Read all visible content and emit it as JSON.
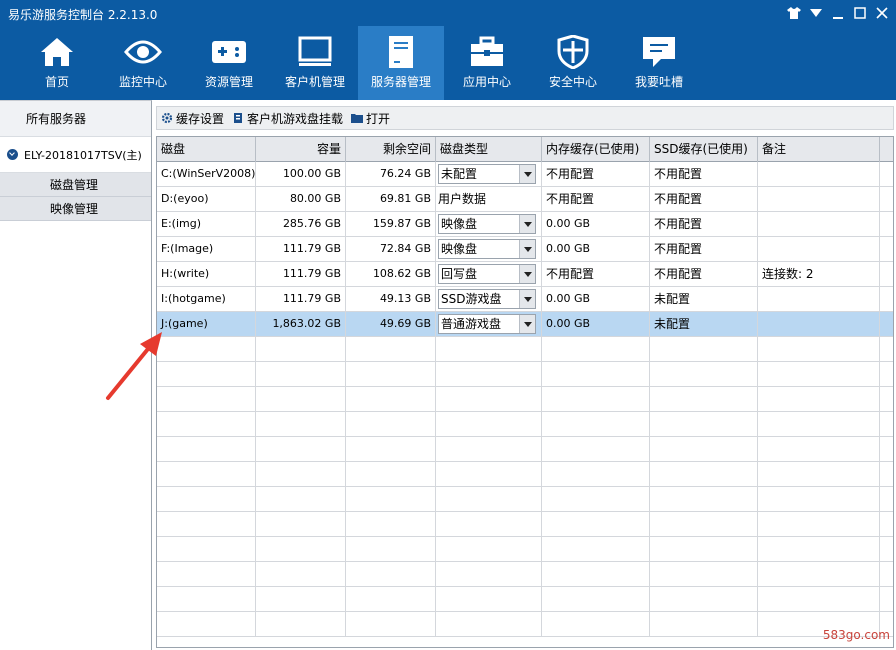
{
  "app": {
    "title": "易乐游服务控制台 2.2.13.0"
  },
  "nav": [
    {
      "label": "首页",
      "icon": "home-icon"
    },
    {
      "label": "监控中心",
      "icon": "eye-icon"
    },
    {
      "label": "资源管理",
      "icon": "gamepad-icon"
    },
    {
      "label": "客户机管理",
      "icon": "monitor-icon"
    },
    {
      "label": "服务器管理",
      "icon": "server-icon",
      "active": true
    },
    {
      "label": "应用中心",
      "icon": "toolbox-icon"
    },
    {
      "label": "安全中心",
      "icon": "shield-icon"
    },
    {
      "label": "我要吐槽",
      "icon": "chat-icon"
    }
  ],
  "sidebar": {
    "all_servers": "所有服务器",
    "server_name": "ELY-20181017TSV(主)",
    "items": [
      "磁盘管理",
      "映像管理"
    ]
  },
  "toolbar": {
    "cache_settings": "缓存设置",
    "mount_client_game_disk": "客户机游戏盘挂载",
    "open": "打开"
  },
  "table": {
    "headers": [
      "磁盘",
      "容量",
      "剩余空间",
      "磁盘类型",
      "内存缓存(已使用)",
      "SSD缓存(已使用)",
      "备注"
    ],
    "rows": [
      {
        "disk": "C:(WinSerV2008)",
        "capacity": "100.00 GB",
        "free": "76.24 GB",
        "type": "未配置",
        "dropdown": true,
        "mem_cache": "不用配置",
        "ssd_cache": "不用配置",
        "note": ""
      },
      {
        "disk": "D:(eyoo)",
        "capacity": "80.00 GB",
        "free": "69.81 GB",
        "type": "用户数据",
        "dropdown": false,
        "mem_cache": "不用配置",
        "ssd_cache": "不用配置",
        "note": ""
      },
      {
        "disk": "E:(img)",
        "capacity": "285.76 GB",
        "free": "159.87 GB",
        "type": "映像盘",
        "dropdown": true,
        "mem_cache": "0.00 GB",
        "ssd_cache": "不用配置",
        "note": ""
      },
      {
        "disk": "F:(Image)",
        "capacity": "111.79 GB",
        "free": "72.84 GB",
        "type": "映像盘",
        "dropdown": true,
        "mem_cache": "0.00 GB",
        "ssd_cache": "不用配置",
        "note": ""
      },
      {
        "disk": "H:(write)",
        "capacity": "111.79 GB",
        "free": "108.62 GB",
        "type": "回写盘",
        "dropdown": true,
        "mem_cache": "不用配置",
        "ssd_cache": "不用配置",
        "note": "连接数: 2"
      },
      {
        "disk": "I:(hotgame)",
        "capacity": "111.79 GB",
        "free": "49.13 GB",
        "type": "SSD游戏盘",
        "dropdown": true,
        "mem_cache": "0.00 GB",
        "ssd_cache": "未配置",
        "note": ""
      },
      {
        "disk": "J:(game)",
        "capacity": "1,863.02 GB",
        "free": "49.69 GB",
        "type": "普通游戏盘",
        "dropdown": true,
        "mem_cache": "0.00 GB",
        "ssd_cache": "未配置",
        "note": "",
        "selected": true
      }
    ]
  },
  "watermark": "583go.com",
  "colors": {
    "header": "#0c5ba3",
    "nav_active": "#2a7dc6",
    "selected_row": "#b9d7f2",
    "arrow": "#e63a2e"
  }
}
